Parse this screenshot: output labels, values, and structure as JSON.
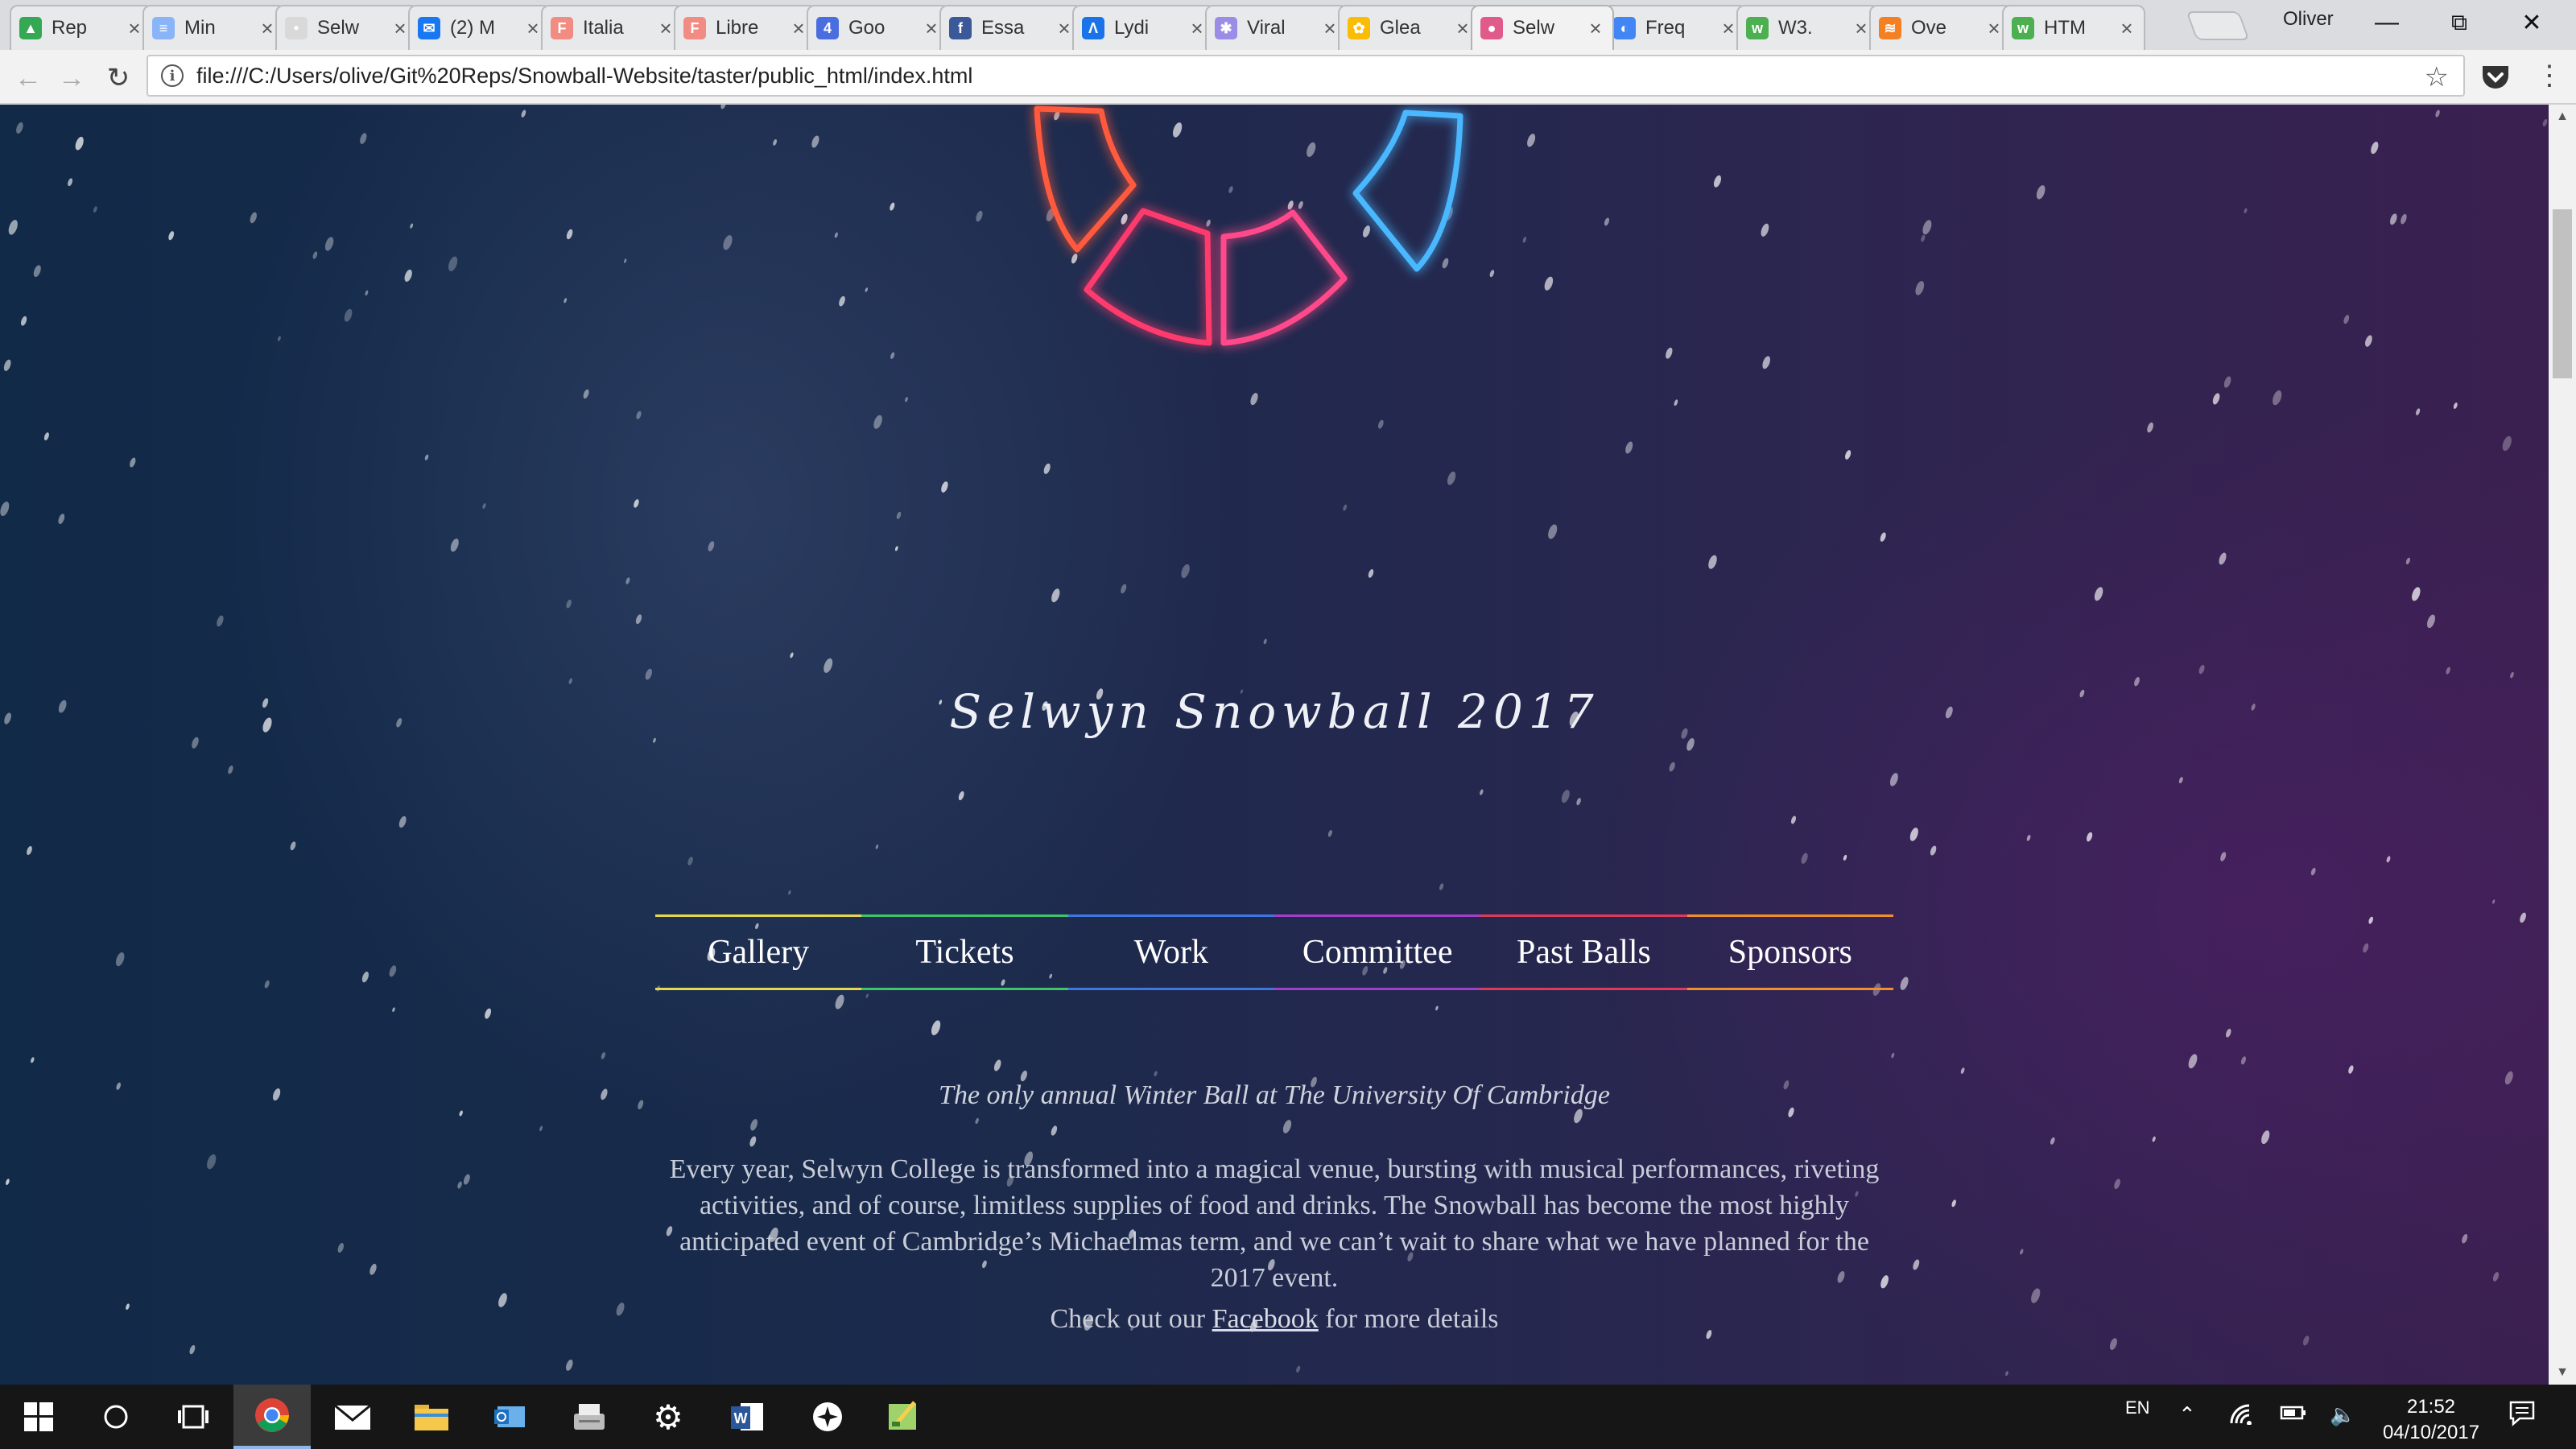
{
  "browser": {
    "tabs": [
      {
        "label": "Rep",
        "favicon_color": "#34a853",
        "glyph": "▲"
      },
      {
        "label": "Min",
        "favicon_color": "#8ab4f8",
        "glyph": "≡"
      },
      {
        "label": "Selw",
        "favicon_color": "#d9d9d9",
        "glyph": "•"
      },
      {
        "label": "(2) M",
        "favicon_color": "#1877f2",
        "glyph": "✉"
      },
      {
        "label": "Italia",
        "favicon_color": "#f28b82",
        "glyph": "F"
      },
      {
        "label": "Libre",
        "favicon_color": "#f28b82",
        "glyph": "F"
      },
      {
        "label": "Goo",
        "favicon_color": "#4a6ee0",
        "glyph": "4"
      },
      {
        "label": "Essa",
        "favicon_color": "#3b5998",
        "glyph": "f"
      },
      {
        "label": "Lydi",
        "favicon_color": "#1a73e8",
        "glyph": "Λ"
      },
      {
        "label": "Viral",
        "favicon_color": "#9b8ce6",
        "glyph": "✱"
      },
      {
        "label": "Glea",
        "favicon_color": "#fbbc04",
        "glyph": "✿"
      },
      {
        "label": "Selw",
        "favicon_color": "#e05a8a",
        "glyph": "●"
      },
      {
        "label": "Freq",
        "favicon_color": "#4285f4",
        "glyph": "◐"
      },
      {
        "label": "W3.",
        "favicon_color": "#4caf50",
        "glyph": "w"
      },
      {
        "label": "Ove",
        "favicon_color": "#f48024",
        "glyph": "≋"
      },
      {
        "label": "HTM",
        "favicon_color": "#4caf50",
        "glyph": "w"
      }
    ],
    "active_tab_index": 11,
    "profile_name": "Oliver",
    "url": "file:///C:/Users/olive/Git%20Reps/Snowball-Website/taster/public_html/index.html"
  },
  "site": {
    "title": "Selwyn Snowball 2017",
    "nav": [
      {
        "label": "Gallery",
        "color": "#e5d84a"
      },
      {
        "label": "Tickets",
        "color": "#3fc46a"
      },
      {
        "label": "Work",
        "color": "#3d78e0"
      },
      {
        "label": "Committee",
        "color": "#a040c8"
      },
      {
        "label": "Past Balls",
        "color": "#e03a5a"
      },
      {
        "label": "Sponsors",
        "color": "#f0902a"
      }
    ],
    "tagline": "The only annual Winter Ball at The University Of Cambridge",
    "intro": "Every year, Selwyn College is transformed into a magical venue, bursting with musical performances, riveting activities, and of course, limitless supplies of food and drinks. The Snowball has become the most highly anticipated event of Cambridge’s Michaelmas term, and we can’t wait to share what we have planned for the 2017 event.",
    "facebook_prefix": "Check out our ",
    "facebook_link": "Facebook",
    "facebook_suffix": " for more details",
    "logo_colors": [
      "#ff5a3c",
      "#ff3a6e",
      "#ff4a8a",
      "#4ab8ff"
    ]
  },
  "taskbar": {
    "language": "EN",
    "time": "21:52",
    "date": "04/10/2017",
    "apps": [
      "windows-start",
      "cortana",
      "task-view",
      "chrome",
      "mail",
      "file-explorer",
      "outlook",
      "scanner",
      "settings",
      "word",
      "sync",
      "paint"
    ]
  }
}
